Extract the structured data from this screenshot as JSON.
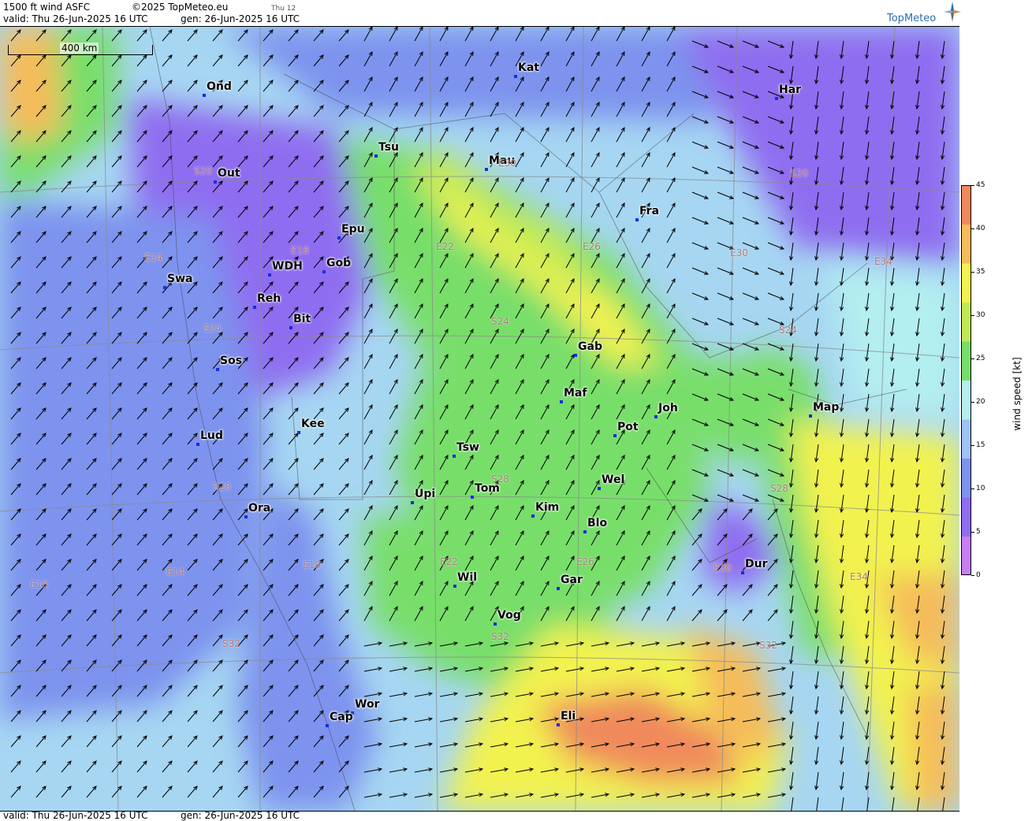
{
  "header": {
    "title": "1500 ft wind ASFC",
    "copyright": "©2025 TopMeteo.eu",
    "run_label": "Thu 12",
    "valid": "valid:  Thu  26-Jun-2025  16 UTC",
    "generated": "gen: 26-Jun-2025 16 UTC"
  },
  "footer": {
    "valid": "valid:  Thu  26-Jun-2025  16 UTC",
    "generated": "gen: 26-Jun-2025 16 UTC"
  },
  "logo": {
    "text": "TopMeteo",
    "icon": "compass-star-icon"
  },
  "scale": {
    "label": "400 km"
  },
  "legend": {
    "title": "wind speed  [kt]",
    "ticks": [
      "45",
      "40",
      "35",
      "30",
      "25",
      "20",
      "15",
      "10",
      "5",
      "0"
    ],
    "color_stops": [
      "#c77ef0",
      "#8f6df0",
      "#7d93ee",
      "#9fc3f5",
      "#b3eef0",
      "#78de6a",
      "#bdea56",
      "#f2f250",
      "#f5bc5a",
      "#f08a5c"
    ]
  },
  "stations": [
    {
      "name": "Ond"
    },
    {
      "name": "Kat"
    },
    {
      "name": "Har"
    },
    {
      "name": "Tsu"
    },
    {
      "name": "Mau"
    },
    {
      "name": "Out"
    },
    {
      "name": "Fra"
    },
    {
      "name": "Epu"
    },
    {
      "name": "Gob"
    },
    {
      "name": "WDH"
    },
    {
      "name": "Swa"
    },
    {
      "name": "Reh"
    },
    {
      "name": "Bit"
    },
    {
      "name": "Gab"
    },
    {
      "name": "Sos"
    },
    {
      "name": "Maf"
    },
    {
      "name": "Joh"
    },
    {
      "name": "Map"
    },
    {
      "name": "Pot"
    },
    {
      "name": "Kee"
    },
    {
      "name": "Lud"
    },
    {
      "name": "Tsw"
    },
    {
      "name": "Wel"
    },
    {
      "name": "Upi"
    },
    {
      "name": "Tom"
    },
    {
      "name": "Kim"
    },
    {
      "name": "Ora"
    },
    {
      "name": "Blo"
    },
    {
      "name": "Dur"
    },
    {
      "name": "Wil"
    },
    {
      "name": "Gar"
    },
    {
      "name": "Vog"
    },
    {
      "name": "Wor"
    },
    {
      "name": "Cap"
    },
    {
      "name": "Eli"
    }
  ],
  "grid_labels": [
    "S20",
    "E30",
    "S20",
    "E14",
    "E18",
    "E22",
    "E26",
    "E30",
    "E34",
    "S24",
    "S24",
    "S24",
    "S28",
    "S28",
    "S28",
    "E10",
    "E14",
    "E18",
    "E22",
    "E26",
    "E30",
    "E34",
    "S32",
    "S32",
    "S32"
  ]
}
